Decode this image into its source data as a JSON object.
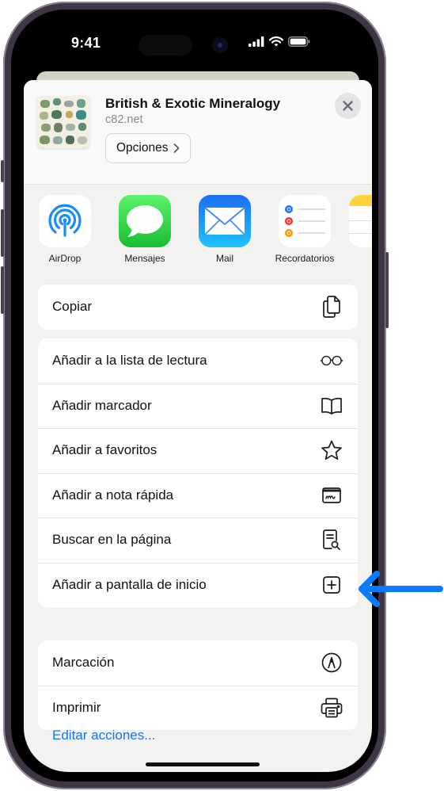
{
  "status_bar": {
    "time": "9:41",
    "icons": [
      "cellular-signal-icon",
      "wifi-icon",
      "battery-icon"
    ]
  },
  "share_sheet": {
    "header": {
      "title": "British & Exotic Mineralogy",
      "subtitle": "c82.net",
      "options_label": "Opciones",
      "options_icon": "chevron-right-icon",
      "close_icon": "close-icon"
    },
    "apps": [
      {
        "label": "AirDrop",
        "icon": "airdrop-icon"
      },
      {
        "label": "Mensajes",
        "icon": "messages-icon"
      },
      {
        "label": "Mail",
        "icon": "mail-icon"
      },
      {
        "label": "Recordatorios",
        "icon": "reminders-icon"
      },
      {
        "label": "",
        "icon": "notes-icon"
      }
    ],
    "action_groups": [
      [
        {
          "label": "Copiar",
          "icon": "copy-icon"
        }
      ],
      [
        {
          "label": "Añadir a la lista de lectura",
          "icon": "glasses-icon"
        },
        {
          "label": "Añadir marcador",
          "icon": "book-icon"
        },
        {
          "label": "Añadir a favoritos",
          "icon": "star-icon"
        },
        {
          "label": "Añadir a nota rápida",
          "icon": "quick-note-icon"
        },
        {
          "label": "Buscar en la página",
          "icon": "find-in-page-icon"
        },
        {
          "label": "Añadir a pantalla de inicio",
          "icon": "add-square-icon"
        }
      ],
      [
        {
          "label": "Marcación",
          "icon": "markup-icon"
        },
        {
          "label": "Imprimir",
          "icon": "printer-icon"
        }
      ]
    ],
    "edit_actions_label": "Editar acciones..."
  },
  "annotation": {
    "icon": "arrow-left-icon",
    "color": "#0a7aff",
    "points_to": "Añadir a pantalla de inicio"
  }
}
